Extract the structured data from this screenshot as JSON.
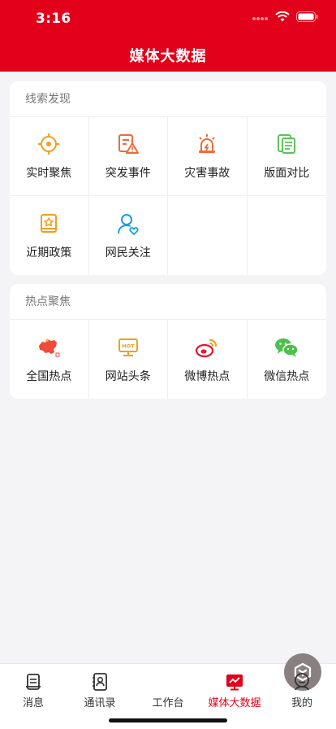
{
  "status_bar": {
    "time": "3:16"
  },
  "nav": {
    "title": "媒体大数据"
  },
  "sections": [
    {
      "title": "线索发现",
      "items": [
        {
          "label": "实时聚焦",
          "icon": "crosshair-icon",
          "color": "#f0a020"
        },
        {
          "label": "突发事件",
          "icon": "alert-document-icon",
          "color": "#f06a3a"
        },
        {
          "label": "灾害事故",
          "icon": "siren-icon",
          "color": "#f06a3a"
        },
        {
          "label": "版面对比",
          "icon": "newspaper-compare-icon",
          "color": "#5cc45c"
        },
        {
          "label": "近期政策",
          "icon": "policy-book-icon",
          "color": "#f0a020"
        },
        {
          "label": "网民关注",
          "icon": "user-heart-icon",
          "color": "#1aa0e0"
        }
      ]
    },
    {
      "title": "热点聚焦",
      "items": [
        {
          "label": "全国热点",
          "icon": "china-map-icon",
          "color": "#f04a3a"
        },
        {
          "label": "网站头条",
          "icon": "hot-monitor-icon",
          "color": "#f0a020"
        },
        {
          "label": "微博热点",
          "icon": "weibo-icon",
          "color": "#e6162d"
        },
        {
          "label": "微信热点",
          "icon": "wechat-icon",
          "color": "#4cbf4c"
        }
      ]
    }
  ],
  "tabbar": {
    "items": [
      {
        "label": "消息",
        "icon": "message-icon"
      },
      {
        "label": "通讯录",
        "icon": "contacts-icon"
      },
      {
        "label": "工作台",
        "icon": "workbench-icon"
      },
      {
        "label": "媒体大数据",
        "icon": "media-data-icon",
        "active": true
      },
      {
        "label": "我的",
        "icon": "profile-icon"
      }
    ]
  },
  "colors": {
    "brand": "#e2001a",
    "background": "#f4f4f6"
  }
}
